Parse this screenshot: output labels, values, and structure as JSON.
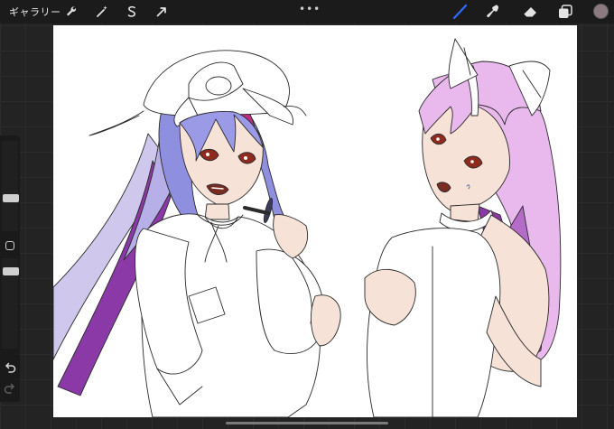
{
  "topbar": {
    "gallery_label": "ギャラリー",
    "actions_icon": "wrench-icon",
    "adjustments_icon": "magic-wand-icon",
    "selection_icon": "selection-s-icon",
    "transform_icon": "arrow-cursor-icon",
    "more_label": "•••",
    "brush_icon": "brush-icon",
    "smudge_icon": "smudge-icon",
    "eraser_icon": "eraser-icon",
    "layers_icon": "layers-icon",
    "active_tool": "brush",
    "brush_color": "#2f6bff"
  },
  "color": {
    "current": "#8c7a80"
  },
  "sidebar": {
    "size_slider_icon": "brush-size-slider",
    "opacity_slider_icon": "opacity-slider",
    "modify_icon": "square-modify-icon",
    "undo_icon": "undo-icon",
    "redo_icon": "redo-icon"
  },
  "canvas": {
    "background": "#ffffff",
    "artwork": "two-anime-girls-illustration"
  }
}
